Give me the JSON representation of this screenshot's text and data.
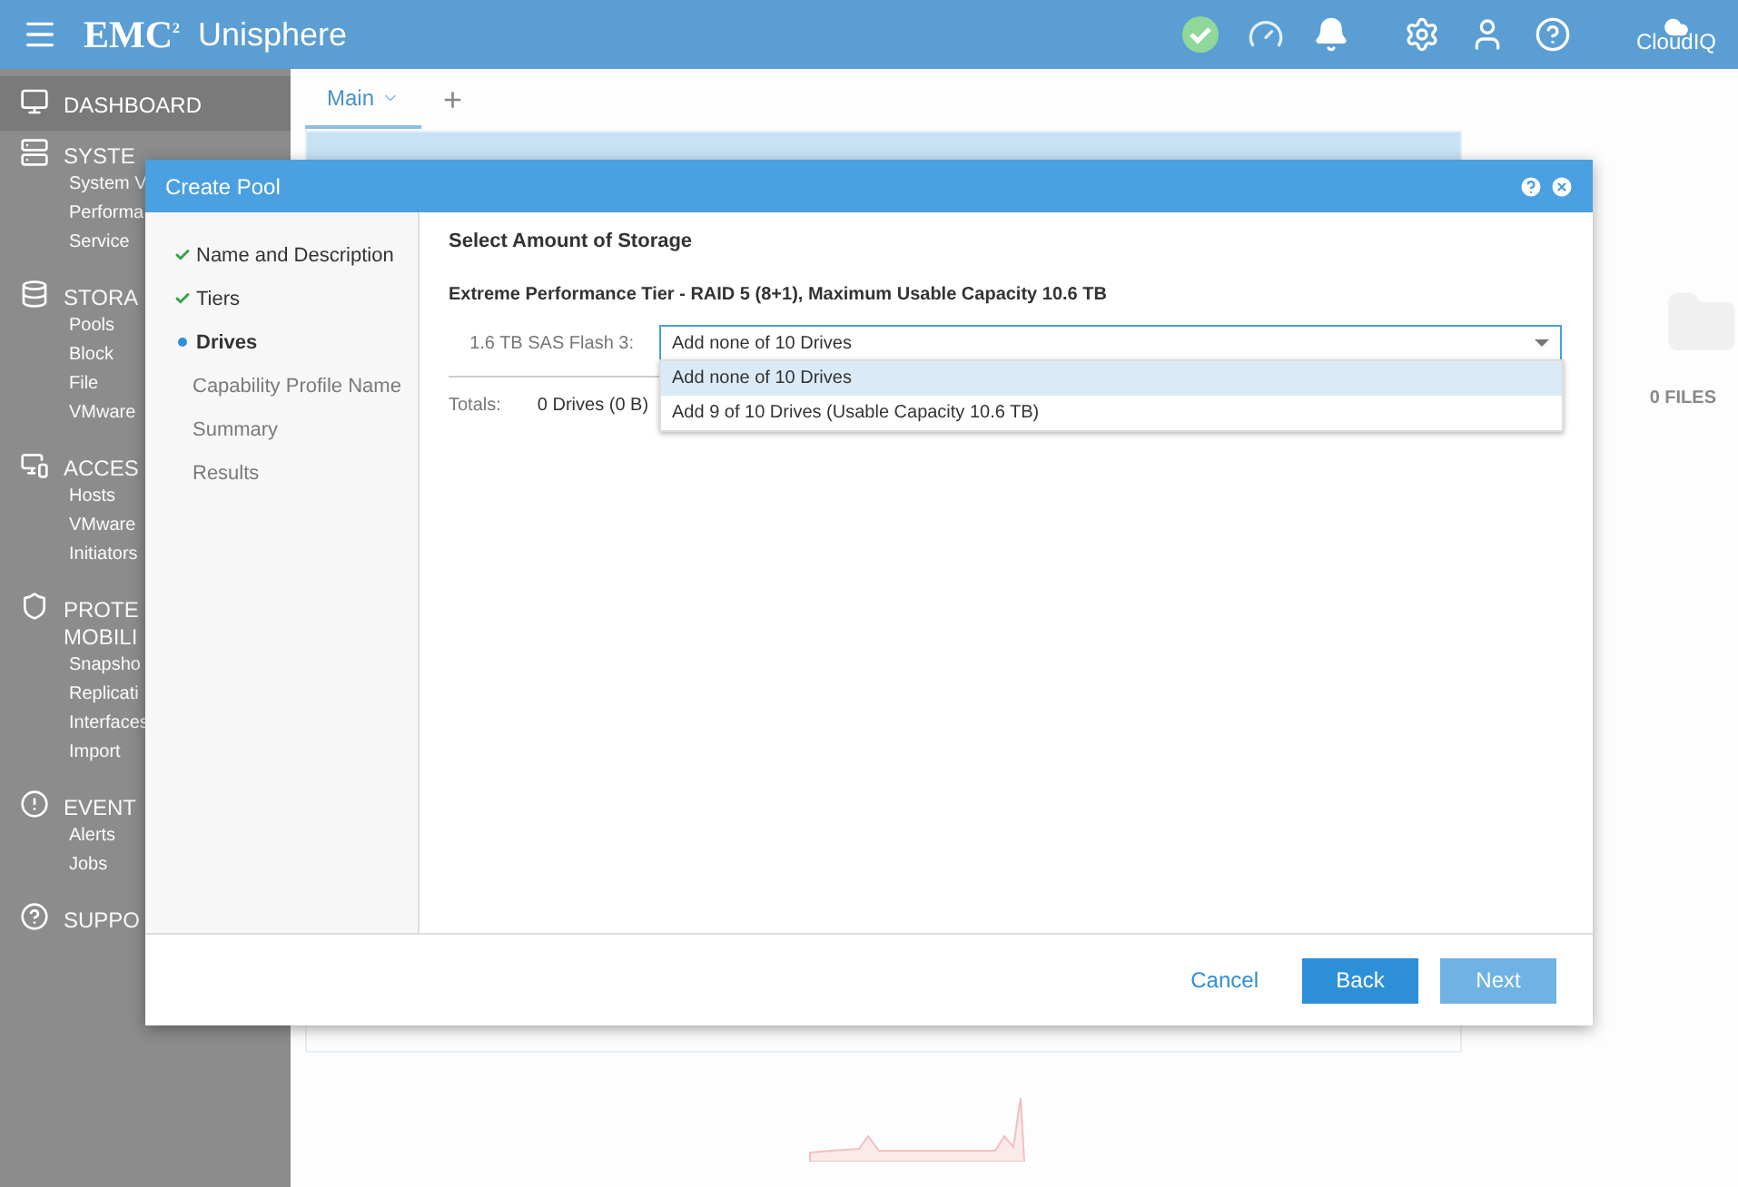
{
  "header": {
    "brand": "EMC",
    "brand_sup": "2",
    "product": "Unisphere",
    "cloud_label": "CloudIQ"
  },
  "sidebar": {
    "sections": [
      {
        "label": "DASHBOARD",
        "kind": "dashboard",
        "selected": true
      },
      {
        "label": "SYSTE",
        "kind": "system",
        "selected": false,
        "items": [
          "System V",
          "Performa",
          "Service"
        ]
      },
      {
        "label": "STORA",
        "kind": "storage",
        "selected": false,
        "items": [
          "Pools",
          "Block",
          "File",
          "VMware"
        ]
      },
      {
        "label": "ACCES",
        "kind": "access",
        "selected": false,
        "items": [
          "Hosts",
          "VMware",
          "Initiators"
        ]
      },
      {
        "label": "PROTE",
        "label2": "MOBILI",
        "kind": "protection",
        "selected": false,
        "items": [
          "Snapsho",
          "Replicati",
          "Interfaces",
          "Import"
        ]
      },
      {
        "label": "EVENT",
        "kind": "events",
        "selected": false,
        "items": [
          "Alerts",
          "Jobs"
        ]
      },
      {
        "label": "SUPPO",
        "kind": "support",
        "selected": false
      }
    ]
  },
  "dashboard": {
    "tabs": [
      {
        "label": "Main",
        "selected": true
      }
    ],
    "add_tab": "+",
    "files_label": "0 FILES"
  },
  "dialog": {
    "title": "Create Pool",
    "steps": [
      {
        "label": "Name and Description",
        "done": true,
        "selected": false
      },
      {
        "label": "Tiers",
        "done": true,
        "selected": false
      },
      {
        "label": "Drives",
        "done": false,
        "selected": true
      },
      {
        "label": "Capability Profile Name",
        "done": false,
        "selected": false
      },
      {
        "label": "Summary",
        "done": false,
        "selected": false
      },
      {
        "label": "Results",
        "done": false,
        "selected": false
      }
    ],
    "heading": "Select Amount of Storage",
    "tier": "Extreme Performance Tier - RAID 5 (8+1), Maximum Usable Capacity 10.6 TB",
    "drive_label": "1.6 TB SAS Flash 3:",
    "select": {
      "value": "Add none of 10 Drives",
      "expanded": true,
      "options": [
        {
          "label": "Add none of 10 Drives",
          "selected": true
        },
        {
          "label": "Add 9 of 10 Drives (Usable Capacity 10.6 TB)",
          "selected": false
        }
      ]
    },
    "totals_label": "Totals:",
    "totals_value": "0 Drives (0 B)",
    "buttons": [
      {
        "label": "Cancel",
        "kind": "link"
      },
      {
        "label": "Back",
        "kind": "primary"
      },
      {
        "label": "Next",
        "kind": "disabled"
      }
    ]
  }
}
